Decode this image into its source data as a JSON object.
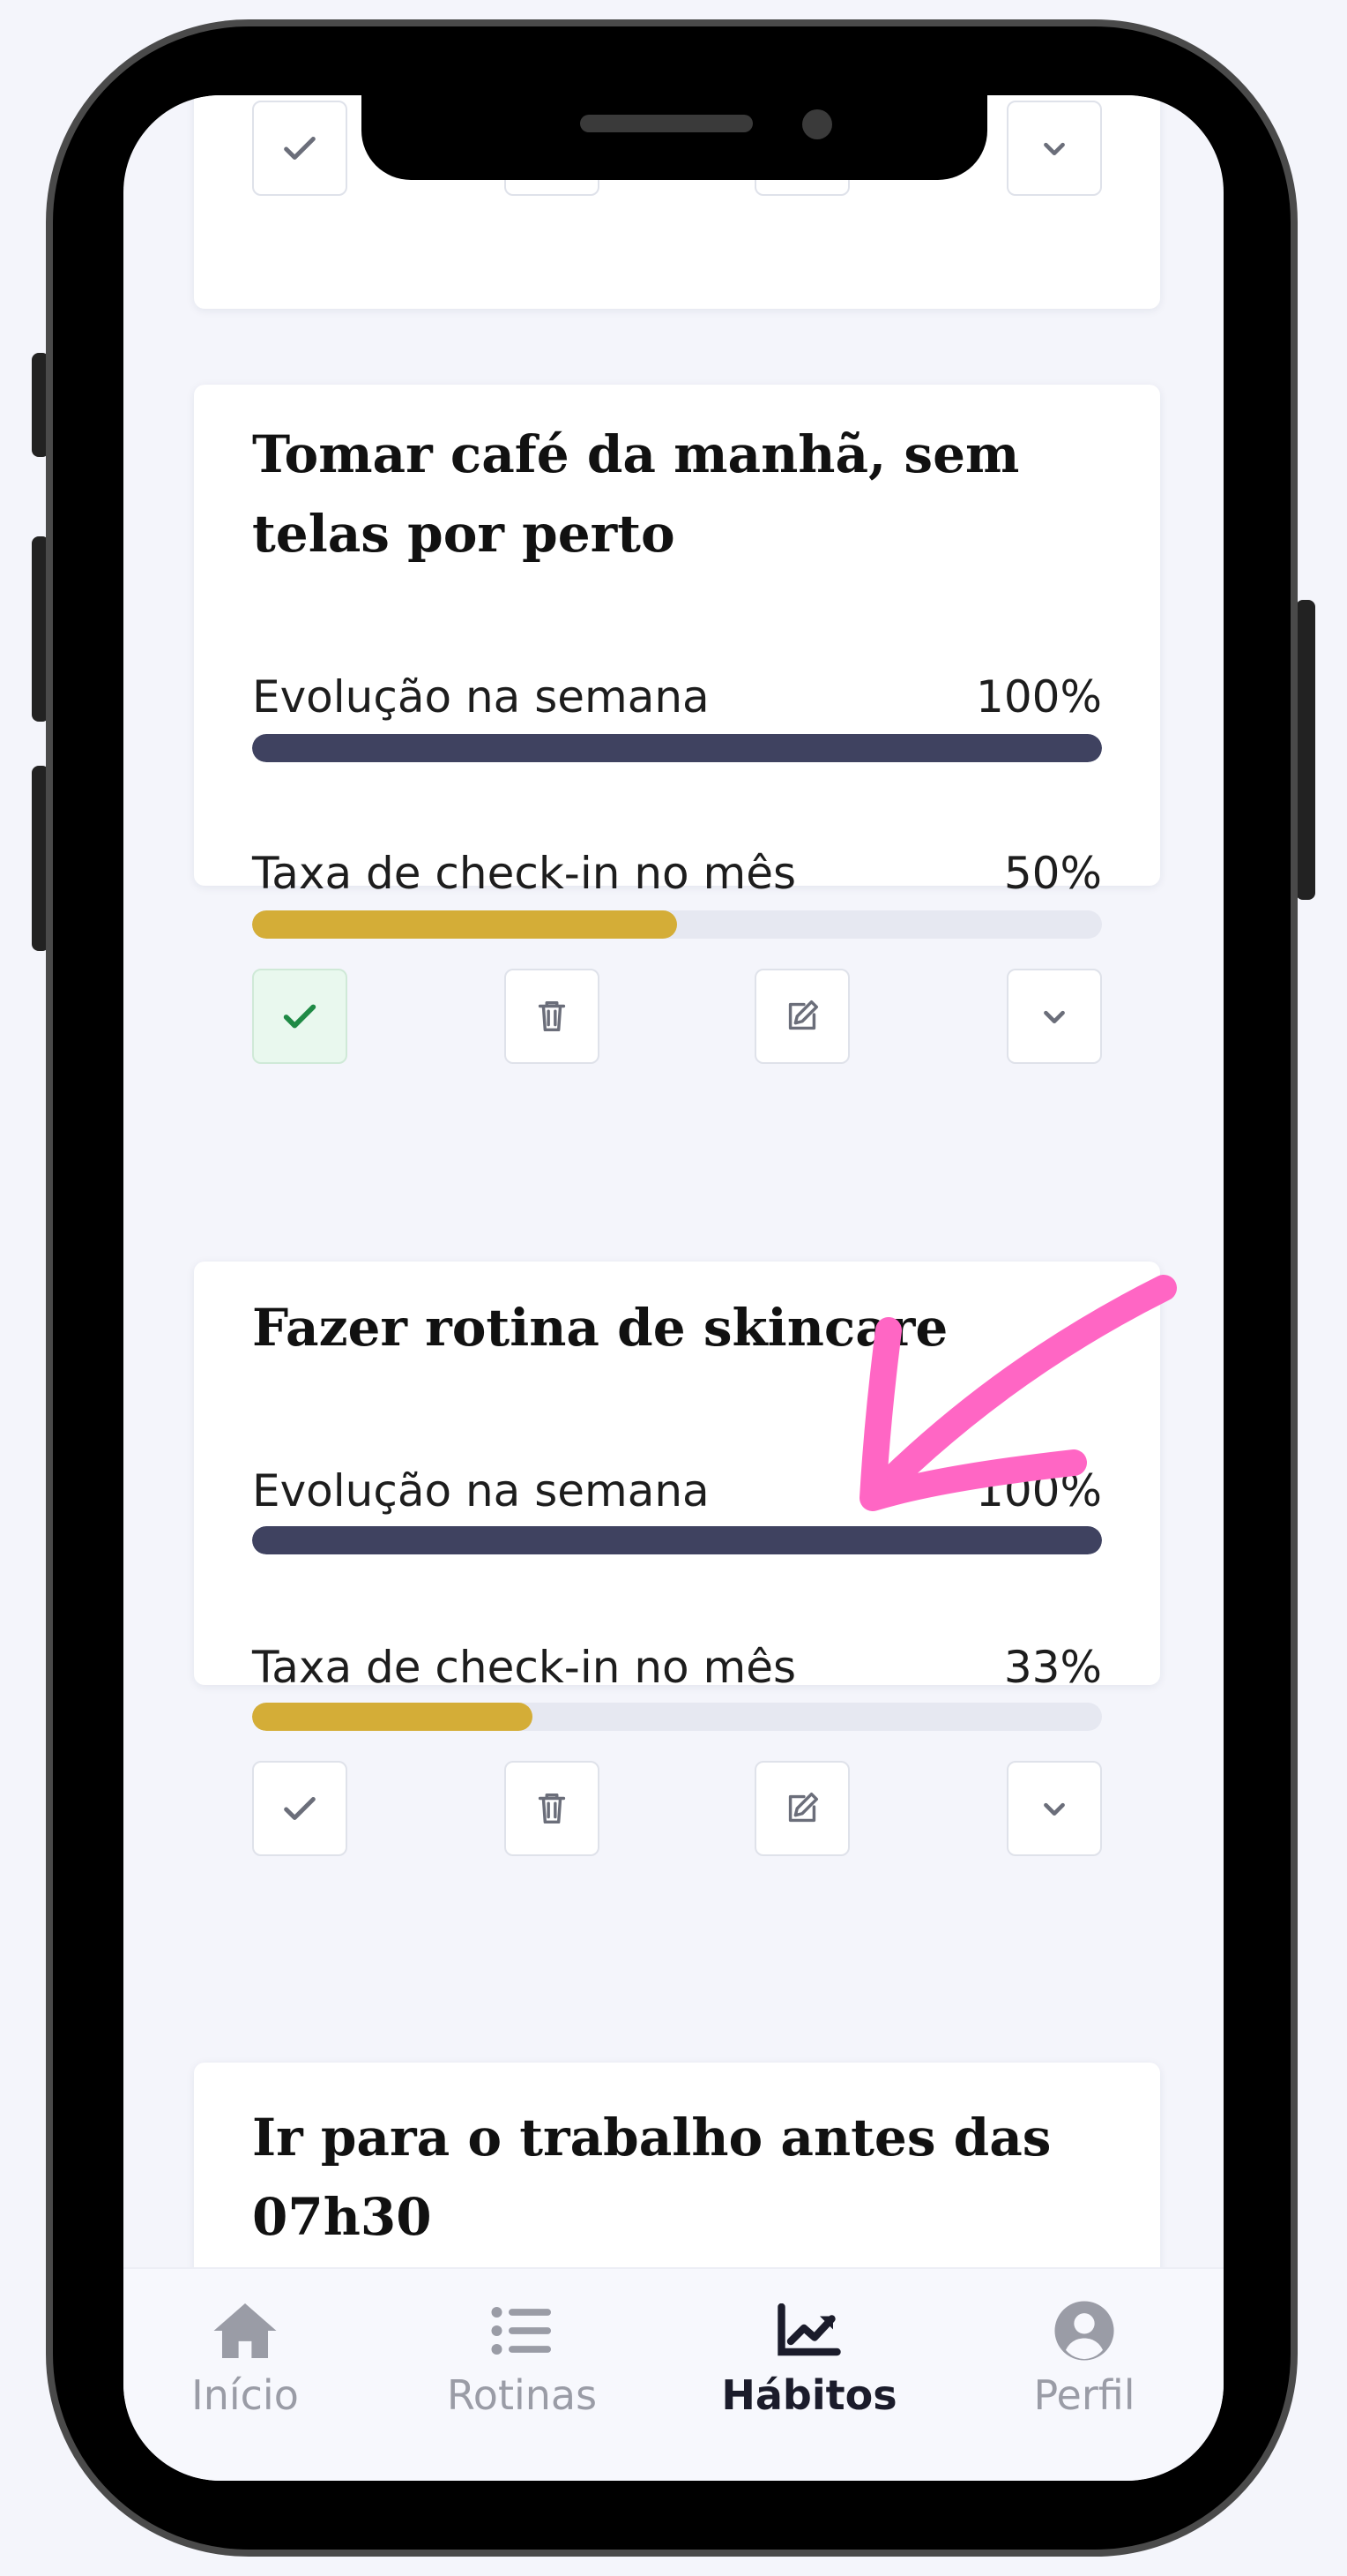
{
  "colors": {
    "week_bar": "#3f4260",
    "month_bar": "#d4ad37",
    "check_done": "#1f8a45",
    "annotation_arrow": "#ff66c4",
    "tab_active": "#1b1c2b",
    "tab_inactive": "#9a9ca6"
  },
  "habits": [
    {
      "title": "",
      "checked": false
    },
    {
      "title": "Tomar café da manhã, sem telas por perto",
      "week_label": "Evolução na semana",
      "week_value": "100%",
      "week_progress": 1.0,
      "month_label": "Taxa de check-in no mês",
      "month_value": "50%",
      "month_progress": 0.5,
      "checked": true
    },
    {
      "title": "Fazer rotina de skincare",
      "week_label": "Evolução na semana",
      "week_value": "100%",
      "week_progress": 1.0,
      "month_label": "Taxa de check-in no mês",
      "month_value": "33%",
      "month_progress": 0.33,
      "checked": false
    },
    {
      "title": "Ir para o trabalho antes das 07h30"
    }
  ],
  "action_icons": [
    "check-icon",
    "trash-icon",
    "edit-icon",
    "chevron-down-icon"
  ],
  "tabs": [
    {
      "label": "Início",
      "icon": "home-icon",
      "active": false
    },
    {
      "label": "Rotinas",
      "icon": "list-icon",
      "active": false
    },
    {
      "label": "Hábitos",
      "icon": "chart-line-icon",
      "active": true
    },
    {
      "label": "Perfil",
      "icon": "user-circle-icon",
      "active": false
    }
  ]
}
